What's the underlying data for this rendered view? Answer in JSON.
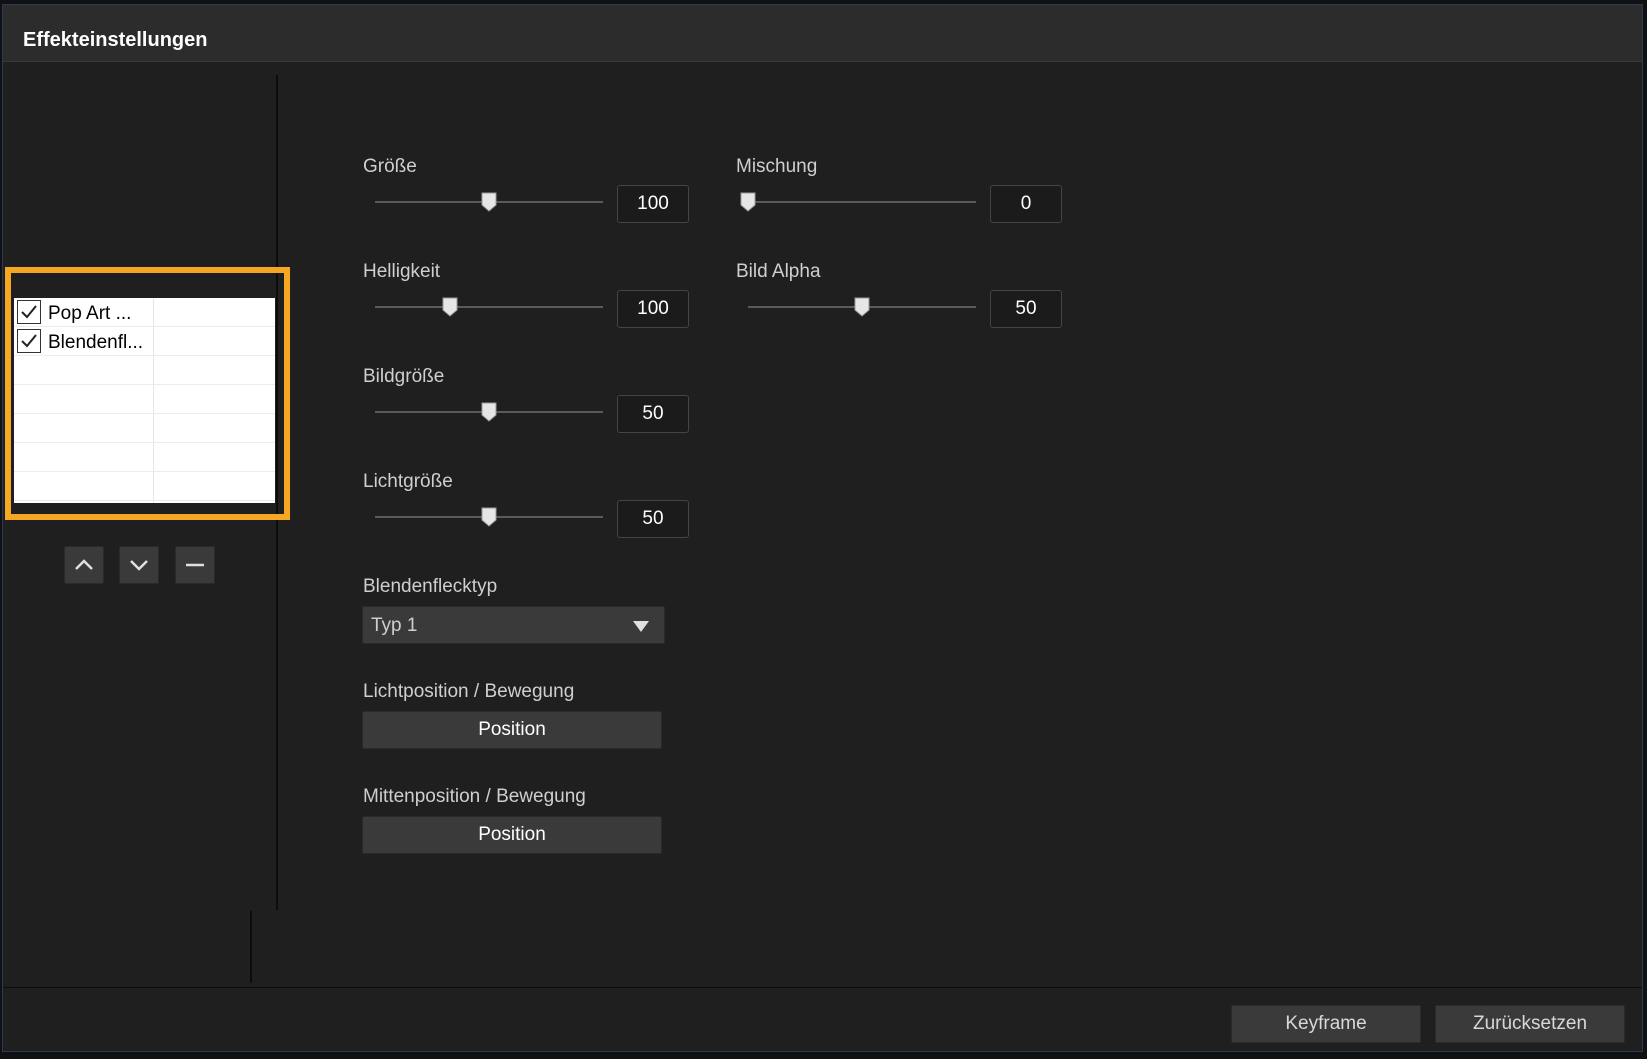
{
  "window": {
    "title": "Effekteinstellungen"
  },
  "effect_list": {
    "items": [
      {
        "label": "Pop Art ...",
        "checked": true
      },
      {
        "label": "Blendenfl...",
        "checked": true
      }
    ],
    "highlight_color": "#f5a623"
  },
  "order_buttons": {
    "up_icon": "chevron-up-icon",
    "down_icon": "chevron-down-icon",
    "remove_icon": "minus-icon"
  },
  "controls": {
    "groesse": {
      "label": "Größe",
      "value": "100",
      "fraction": 0.5
    },
    "mischung": {
      "label": "Mischung",
      "value": "0",
      "fraction": 0.0
    },
    "helligkeit": {
      "label": "Helligkeit",
      "value": "100",
      "fraction": 0.33
    },
    "bild_alpha": {
      "label": "Bild Alpha",
      "value": "50",
      "fraction": 0.5
    },
    "bildgroesse": {
      "label": "Bildgröße",
      "value": "50",
      "fraction": 0.5
    },
    "lichtgroesse": {
      "label": "Lichtgröße",
      "value": "50",
      "fraction": 0.5
    },
    "blendenflecktyp": {
      "label": "Blendenflecktyp",
      "value": "Typ 1"
    },
    "lichtposition": {
      "label": "Lichtposition / Bewegung",
      "button": "Position"
    },
    "mittenposition": {
      "label": "Mittenposition / Bewegung",
      "button": "Position"
    }
  },
  "footer": {
    "keyframe_label": "Keyframe",
    "reset_label": "Zurücksetzen"
  }
}
